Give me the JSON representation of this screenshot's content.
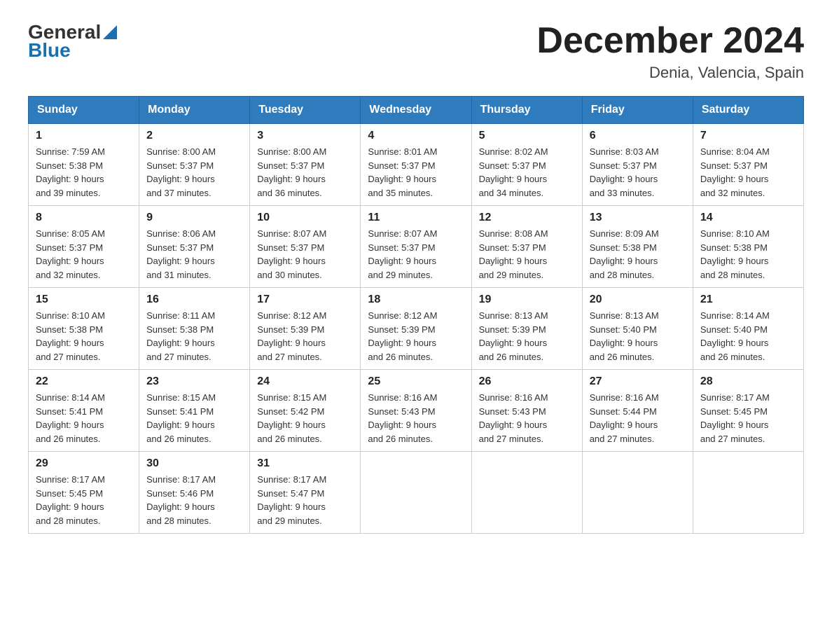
{
  "header": {
    "logo_general": "General",
    "logo_blue": "Blue",
    "month_title": "December 2024",
    "location": "Denia, Valencia, Spain"
  },
  "days_of_week": [
    "Sunday",
    "Monday",
    "Tuesday",
    "Wednesday",
    "Thursday",
    "Friday",
    "Saturday"
  ],
  "weeks": [
    [
      {
        "day": "1",
        "sunrise": "7:59 AM",
        "sunset": "5:38 PM",
        "daylight": "9 hours and 39 minutes."
      },
      {
        "day": "2",
        "sunrise": "8:00 AM",
        "sunset": "5:37 PM",
        "daylight": "9 hours and 37 minutes."
      },
      {
        "day": "3",
        "sunrise": "8:00 AM",
        "sunset": "5:37 PM",
        "daylight": "9 hours and 36 minutes."
      },
      {
        "day": "4",
        "sunrise": "8:01 AM",
        "sunset": "5:37 PM",
        "daylight": "9 hours and 35 minutes."
      },
      {
        "day": "5",
        "sunrise": "8:02 AM",
        "sunset": "5:37 PM",
        "daylight": "9 hours and 34 minutes."
      },
      {
        "day": "6",
        "sunrise": "8:03 AM",
        "sunset": "5:37 PM",
        "daylight": "9 hours and 33 minutes."
      },
      {
        "day": "7",
        "sunrise": "8:04 AM",
        "sunset": "5:37 PM",
        "daylight": "9 hours and 32 minutes."
      }
    ],
    [
      {
        "day": "8",
        "sunrise": "8:05 AM",
        "sunset": "5:37 PM",
        "daylight": "9 hours and 32 minutes."
      },
      {
        "day": "9",
        "sunrise": "8:06 AM",
        "sunset": "5:37 PM",
        "daylight": "9 hours and 31 minutes."
      },
      {
        "day": "10",
        "sunrise": "8:07 AM",
        "sunset": "5:37 PM",
        "daylight": "9 hours and 30 minutes."
      },
      {
        "day": "11",
        "sunrise": "8:07 AM",
        "sunset": "5:37 PM",
        "daylight": "9 hours and 29 minutes."
      },
      {
        "day": "12",
        "sunrise": "8:08 AM",
        "sunset": "5:37 PM",
        "daylight": "9 hours and 29 minutes."
      },
      {
        "day": "13",
        "sunrise": "8:09 AM",
        "sunset": "5:38 PM",
        "daylight": "9 hours and 28 minutes."
      },
      {
        "day": "14",
        "sunrise": "8:10 AM",
        "sunset": "5:38 PM",
        "daylight": "9 hours and 28 minutes."
      }
    ],
    [
      {
        "day": "15",
        "sunrise": "8:10 AM",
        "sunset": "5:38 PM",
        "daylight": "9 hours and 27 minutes."
      },
      {
        "day": "16",
        "sunrise": "8:11 AM",
        "sunset": "5:38 PM",
        "daylight": "9 hours and 27 minutes."
      },
      {
        "day": "17",
        "sunrise": "8:12 AM",
        "sunset": "5:39 PM",
        "daylight": "9 hours and 27 minutes."
      },
      {
        "day": "18",
        "sunrise": "8:12 AM",
        "sunset": "5:39 PM",
        "daylight": "9 hours and 26 minutes."
      },
      {
        "day": "19",
        "sunrise": "8:13 AM",
        "sunset": "5:39 PM",
        "daylight": "9 hours and 26 minutes."
      },
      {
        "day": "20",
        "sunrise": "8:13 AM",
        "sunset": "5:40 PM",
        "daylight": "9 hours and 26 minutes."
      },
      {
        "day": "21",
        "sunrise": "8:14 AM",
        "sunset": "5:40 PM",
        "daylight": "9 hours and 26 minutes."
      }
    ],
    [
      {
        "day": "22",
        "sunrise": "8:14 AM",
        "sunset": "5:41 PM",
        "daylight": "9 hours and 26 minutes."
      },
      {
        "day": "23",
        "sunrise": "8:15 AM",
        "sunset": "5:41 PM",
        "daylight": "9 hours and 26 minutes."
      },
      {
        "day": "24",
        "sunrise": "8:15 AM",
        "sunset": "5:42 PM",
        "daylight": "9 hours and 26 minutes."
      },
      {
        "day": "25",
        "sunrise": "8:16 AM",
        "sunset": "5:43 PM",
        "daylight": "9 hours and 26 minutes."
      },
      {
        "day": "26",
        "sunrise": "8:16 AM",
        "sunset": "5:43 PM",
        "daylight": "9 hours and 27 minutes."
      },
      {
        "day": "27",
        "sunrise": "8:16 AM",
        "sunset": "5:44 PM",
        "daylight": "9 hours and 27 minutes."
      },
      {
        "day": "28",
        "sunrise": "8:17 AM",
        "sunset": "5:45 PM",
        "daylight": "9 hours and 27 minutes."
      }
    ],
    [
      {
        "day": "29",
        "sunrise": "8:17 AM",
        "sunset": "5:45 PM",
        "daylight": "9 hours and 28 minutes."
      },
      {
        "day": "30",
        "sunrise": "8:17 AM",
        "sunset": "5:46 PM",
        "daylight": "9 hours and 28 minutes."
      },
      {
        "day": "31",
        "sunrise": "8:17 AM",
        "sunset": "5:47 PM",
        "daylight": "9 hours and 29 minutes."
      },
      null,
      null,
      null,
      null
    ]
  ]
}
